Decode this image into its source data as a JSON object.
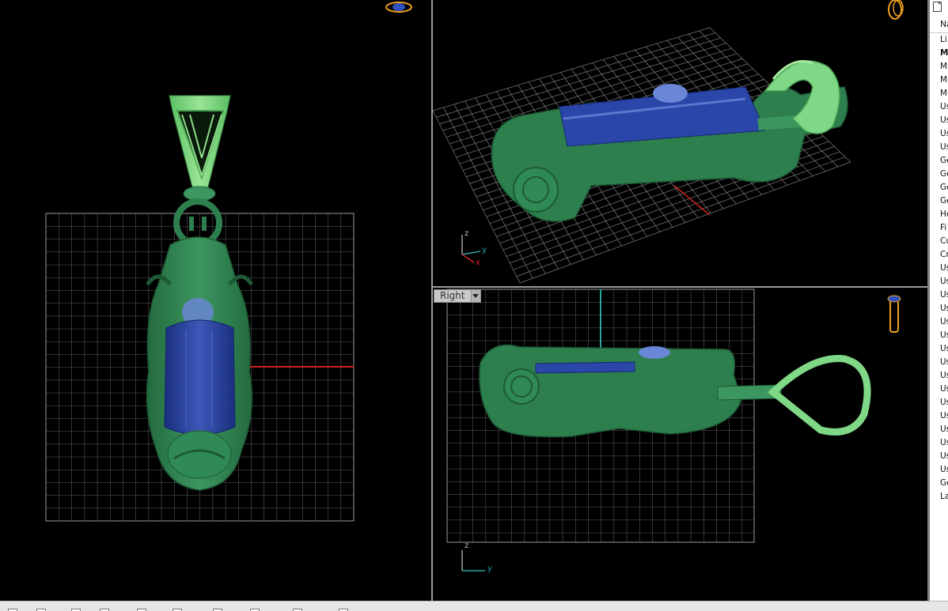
{
  "viewports": {
    "right_label": "Right",
    "view_menu_icon": "chevron-down-icon",
    "axes": {
      "z": "z",
      "y": "y",
      "x": "x"
    }
  },
  "colors": {
    "jade_dark": "#2d7f4e",
    "jade_light": "#6fd07a",
    "sapphire": "#1f3d9e",
    "grid": "#8c8c8c",
    "axis_x": "#d02020",
    "axis_z": "#2aa3a3",
    "gumball": "#f0a020"
  },
  "side_panel": {
    "header_icon": "document-icon",
    "column_header": "Na",
    "layers": [
      "Li",
      "M",
      "M",
      "M",
      "M",
      "Us",
      "Us",
      "Us",
      "Us",
      "Ge",
      "Ge",
      "Ge",
      "Ge",
      "He",
      "Fi",
      "Cu",
      "Cr",
      "Us",
      "Us",
      "Us",
      "Us",
      "Us",
      "Us",
      "Us",
      "Us",
      "Us",
      "Us",
      "Us",
      "Us",
      "Us",
      "Us",
      "Us",
      "Us",
      "Ge",
      "La"
    ],
    "current_index": 1
  },
  "status_bar": {
    "osnap_count": 10
  }
}
